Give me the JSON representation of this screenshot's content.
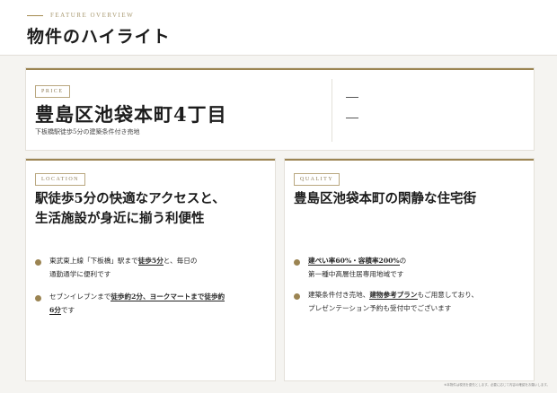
{
  "header": {
    "eyebrow": "FEATURE OVERVIEW",
    "title": "物件のハイライト"
  },
  "price_card": {
    "tag": "PRICE",
    "title": "豊島区池袋本町4丁目",
    "subtitle": "下板橋駅徒歩5分の建築条件付き売地",
    "values": [
      "—",
      "—"
    ]
  },
  "location_card": {
    "tag": "LOCATION",
    "heading_line1": "駅徒歩5分の快適なアクセスと、",
    "heading_line2": "生活施設が身近に揃う利便性",
    "bullets": [
      {
        "a": "東武東上線「下板橋」駅まで",
        "b": "徒歩5分",
        "c": "と、毎日の",
        "d": "通勤通学に便利です"
      },
      {
        "a": "セブンイレブンまで",
        "b": "徒歩約2分、ヨークマートまで徒歩約",
        "c": "6分",
        "d": "です"
      }
    ]
  },
  "quality_card": {
    "tag": "QUALITY",
    "heading": "豊島区池袋本町の閑静な住宅街",
    "bullets": [
      {
        "a": "建ぺい率60%・容積率200%",
        "b": "の",
        "c": "第一種中高層住居専用地域です"
      },
      {
        "a": "建築条件付き売地、",
        "b": "建物参考プラン",
        "c": "もご用意しており、",
        "d": "プレゼンテーション予約も受付中でございます"
      }
    ]
  },
  "footnote": "※本物件は現況を優先とします。必要に応じて内容の確認をお願いします。",
  "colors": {
    "accent_gold": "#9b8452",
    "background": "#f5f4f1",
    "card": "#ffffff"
  }
}
